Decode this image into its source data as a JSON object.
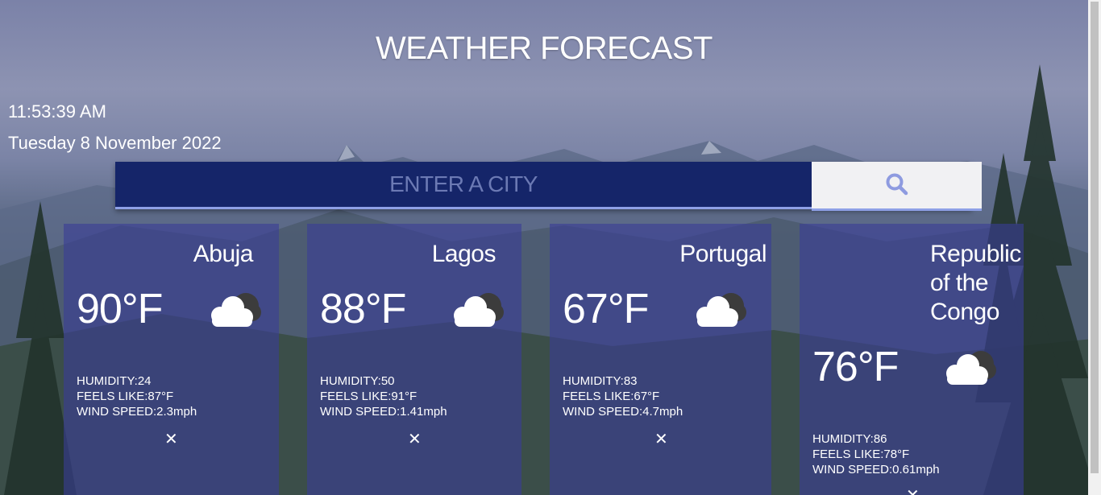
{
  "header": {
    "title": "WEATHER FORECAST"
  },
  "clock": {
    "time": "11:53:39 AM",
    "date": "Tuesday 8 November 2022"
  },
  "search": {
    "placeholder": "ENTER A CITY",
    "value": "",
    "button_icon": "search-icon"
  },
  "cards": [
    {
      "city": "Abuja",
      "temp": "90°F",
      "humidity": "HUMIDITY:24",
      "feels_like": "FEELS LIKE:87°F",
      "wind": "WIND SPEED:2.3mph",
      "close": "✕",
      "icon": "cloud-icon"
    },
    {
      "city": "Lagos",
      "temp": "88°F",
      "humidity": "HUMIDITY:50",
      "feels_like": "FEELS LIKE:91°F",
      "wind": "WIND SPEED:1.41mph",
      "close": "✕",
      "icon": "cloud-icon"
    },
    {
      "city": "Portugal",
      "temp": "67°F",
      "humidity": "HUMIDITY:83",
      "feels_like": "FEELS LIKE:67°F",
      "wind": "WIND SPEED:4.7mph",
      "close": "✕",
      "icon": "cloud-icon"
    },
    {
      "city_lines": [
        "Republic",
        "of the",
        "Congo"
      ],
      "temp": "76°F",
      "humidity": "HUMIDITY:86",
      "feels_like": "FEELS LIKE:78°F",
      "wind": "WIND SPEED:0.61mph",
      "close": "✕",
      "icon": "cloud-icon"
    }
  ],
  "colors": {
    "search_bg": "#152569",
    "accent": "#8ea0e6",
    "card_bg": "#3a3e96",
    "search_icon": "#8e9be0"
  }
}
